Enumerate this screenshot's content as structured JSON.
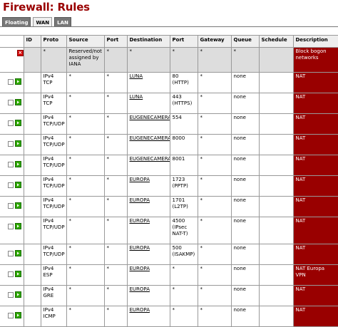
{
  "page": {
    "title": "Firewall: Rules"
  },
  "tabs": [
    {
      "label": "Floating",
      "active": false
    },
    {
      "label": "WAN",
      "active": true
    },
    {
      "label": "LAN",
      "active": false
    }
  ],
  "columns": [
    "ID",
    "Proto",
    "Source",
    "Port",
    "Destination",
    "Port",
    "Gateway",
    "Queue",
    "Schedule",
    "Description"
  ],
  "colors": {
    "title": "#990000",
    "description_bg": "#990000",
    "pass_icon": "#2ea800",
    "block_icon": "#d40000"
  },
  "rules": [
    {
      "action": "block",
      "checkbox": false,
      "id": "",
      "proto": "*",
      "source": "Reserved/not assigned by IANA",
      "sport": "*",
      "dest": "*",
      "dport": "*",
      "gateway": "*",
      "queue": "*",
      "schedule": "",
      "description": "Block bogon networks",
      "dest_link": false
    },
    {
      "action": "pass",
      "id": "",
      "proto": "IPv4 TCP",
      "source": "*",
      "sport": "*",
      "dest": "LUNA",
      "dport": "80 (HTTP)",
      "gateway": "*",
      "queue": "none",
      "schedule": "",
      "description": "NAT",
      "dest_link": true
    },
    {
      "action": "pass",
      "id": "",
      "proto": "IPv4 TCP",
      "source": "*",
      "sport": "*",
      "dest": "LUNA",
      "dport": "443 (HTTPS)",
      "gateway": "*",
      "queue": "none",
      "schedule": "",
      "description": "NAT",
      "dest_link": true
    },
    {
      "action": "pass",
      "id": "",
      "proto": "IPv4 TCP/UDP",
      "source": "*",
      "sport": "*",
      "dest": "EUGENECAMERA",
      "dport": "554",
      "gateway": "*",
      "queue": "none",
      "schedule": "",
      "description": "NAT",
      "dest_link": true
    },
    {
      "action": "pass",
      "id": "",
      "proto": "IPv4 TCP/UDP",
      "source": "*",
      "sport": "*",
      "dest": "EUGENECAMERA",
      "dport": "8000",
      "gateway": "*",
      "queue": "none",
      "schedule": "",
      "description": "NAT",
      "dest_link": true
    },
    {
      "action": "pass",
      "id": "",
      "proto": "IPv4 TCP/UDP",
      "source": "*",
      "sport": "*",
      "dest": "EUGENECAMERA",
      "dport": "8001",
      "gateway": "*",
      "queue": "none",
      "schedule": "",
      "description": "NAT",
      "dest_link": true
    },
    {
      "action": "pass",
      "id": "",
      "proto": "IPv4 TCP/UDP",
      "source": "*",
      "sport": "*",
      "dest": "EUROPA",
      "dport": "1723 (PPTP)",
      "gateway": "*",
      "queue": "none",
      "schedule": "",
      "description": "NAT",
      "dest_link": true
    },
    {
      "action": "pass",
      "id": "",
      "proto": "IPv4 TCP/UDP",
      "source": "*",
      "sport": "*",
      "dest": "EUROPA",
      "dport": "1701 (L2TP)",
      "gateway": "*",
      "queue": "none",
      "schedule": "",
      "description": "NAT",
      "dest_link": true
    },
    {
      "action": "pass",
      "id": "",
      "proto": "IPv4 TCP/UDP",
      "source": "*",
      "sport": "*",
      "dest": "EUROPA",
      "dport": "4500 (IPsec NAT-T)",
      "gateway": "*",
      "queue": "none",
      "schedule": "",
      "description": "NAT",
      "dest_link": true
    },
    {
      "action": "pass",
      "id": "",
      "proto": "IPv4 TCP/UDP",
      "source": "*",
      "sport": "*",
      "dest": "EUROPA",
      "dport": "500 (ISAKMP)",
      "gateway": "*",
      "queue": "none",
      "schedule": "",
      "description": "NAT",
      "dest_link": true
    },
    {
      "action": "pass",
      "id": "",
      "proto": "IPv4 ESP",
      "source": "*",
      "sport": "*",
      "dest": "EUROPA",
      "dport": "*",
      "gateway": "*",
      "queue": "none",
      "schedule": "",
      "description": "NAT Europa VPN",
      "dest_link": true
    },
    {
      "action": "pass",
      "id": "",
      "proto": "IPv4 GRE",
      "source": "*",
      "sport": "*",
      "dest": "EUROPA",
      "dport": "*",
      "gateway": "*",
      "queue": "none",
      "schedule": "",
      "description": "NAT",
      "dest_link": true
    },
    {
      "action": "pass",
      "id": "",
      "proto": "IPv4 ICMP",
      "source": "*",
      "sport": "*",
      "dest": "EUROPA",
      "dport": "*",
      "gateway": "*",
      "queue": "none",
      "schedule": "",
      "description": "NAT",
      "dest_link": true
    }
  ]
}
